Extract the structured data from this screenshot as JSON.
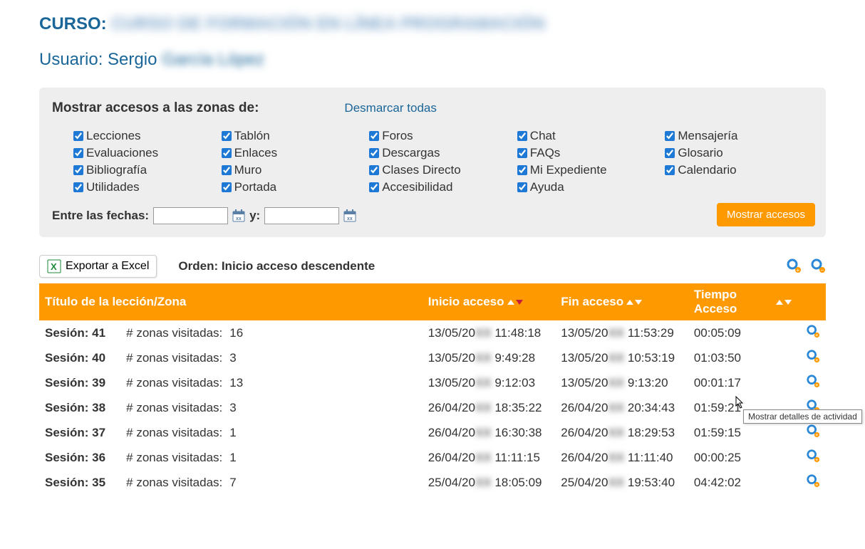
{
  "header": {
    "course_label": "CURSO:",
    "course_name": "CURSO DE FORMACIÓN EN LÍNEA PROGRAMACIÓN",
    "user_label": "Usuario:",
    "user_name_visible": "Sergio",
    "user_name_rest": "García López"
  },
  "panel": {
    "title": "Mostrar accesos a las zonas de:",
    "uncheck_all": "Desmarcar todas",
    "checkboxes": [
      "Lecciones",
      "Tablón",
      "Foros",
      "Chat",
      "Mensajería",
      "Evaluaciones",
      "Enlaces",
      "Descargas",
      "FAQs",
      "Glosario",
      "Bibliografía",
      "Muro",
      "Clases Directo",
      "Mi Expediente",
      "Calendario",
      "Utilidades",
      "Portada",
      "Accesibilidad",
      "Ayuda"
    ],
    "dates_label": "Entre las fechas:",
    "and_label": "y:",
    "show_button": "Mostrar accesos"
  },
  "toolbar": {
    "export_label": "Exportar a Excel",
    "order_label": "Orden: Inicio acceso descendente"
  },
  "table": {
    "headers": {
      "title": "Título de la lección/Zona",
      "start": "Inicio acceso",
      "end": "Fin acceso",
      "time": "Tiempo Acceso"
    },
    "session_label": "Sesión:",
    "zones_label": "# zonas visitadas:",
    "rows": [
      {
        "num": "41",
        "zones": "16",
        "start_d": "13/05/20",
        "start_t": "11:48:18",
        "end_d": "13/05/20",
        "end_t": "11:53:29",
        "time": "00:05:09"
      },
      {
        "num": "40",
        "zones": "3",
        "start_d": "13/05/20",
        "start_t": "9:49:28",
        "end_d": "13/05/20",
        "end_t": "10:53:19",
        "time": "01:03:50"
      },
      {
        "num": "39",
        "zones": "13",
        "start_d": "13/05/20",
        "start_t": "9:12:03",
        "end_d": "13/05/20",
        "end_t": "9:13:20",
        "time": "00:01:17"
      },
      {
        "num": "38",
        "zones": "3",
        "start_d": "26/04/20",
        "start_t": "18:35:22",
        "end_d": "26/04/20",
        "end_t": "20:34:43",
        "time": "01:59:21"
      },
      {
        "num": "37",
        "zones": "1",
        "start_d": "26/04/20",
        "start_t": "16:30:38",
        "end_d": "26/04/20",
        "end_t": "18:29:53",
        "time": "01:59:15"
      },
      {
        "num": "36",
        "zones": "1",
        "start_d": "26/04/20",
        "start_t": "11:11:15",
        "end_d": "26/04/20",
        "end_t": "11:11:40",
        "time": "00:00:25"
      },
      {
        "num": "35",
        "zones": "7",
        "start_d": "25/04/20",
        "start_t": "18:05:09",
        "end_d": "25/04/20",
        "end_t": "19:53:40",
        "time": "04:42:02"
      }
    ]
  },
  "tooltip": "Mostrar detalles de actividad"
}
